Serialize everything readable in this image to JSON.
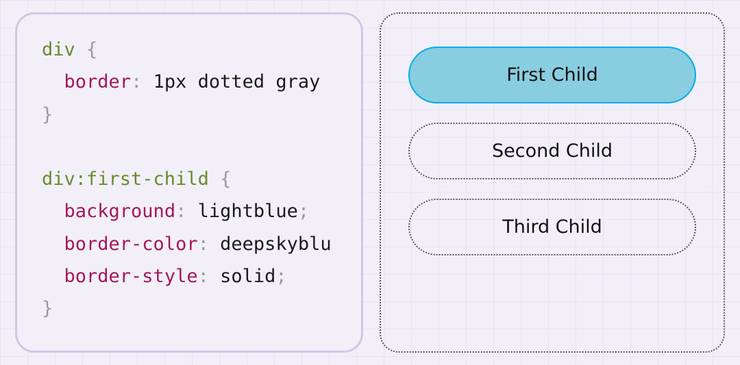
{
  "code": {
    "selector1": "div",
    "brace_open": "{",
    "brace_close": "}",
    "prop_border": "border",
    "val_border": "1px dotted gray",
    "selector2": "div:first-child",
    "prop_bg": "background",
    "val_bg": "lightblue",
    "prop_bc": "border-color",
    "val_bc": "deepskyblu",
    "prop_bs": "border-style",
    "val_bs": "solid",
    "colon": ":",
    "semicolon": ";"
  },
  "children": [
    {
      "label": "First Child"
    },
    {
      "label": "Second Child"
    },
    {
      "label": "Third Child"
    }
  ],
  "colors": {
    "first_child_bg": "#89cde0",
    "first_child_border": "#00aee6"
  }
}
